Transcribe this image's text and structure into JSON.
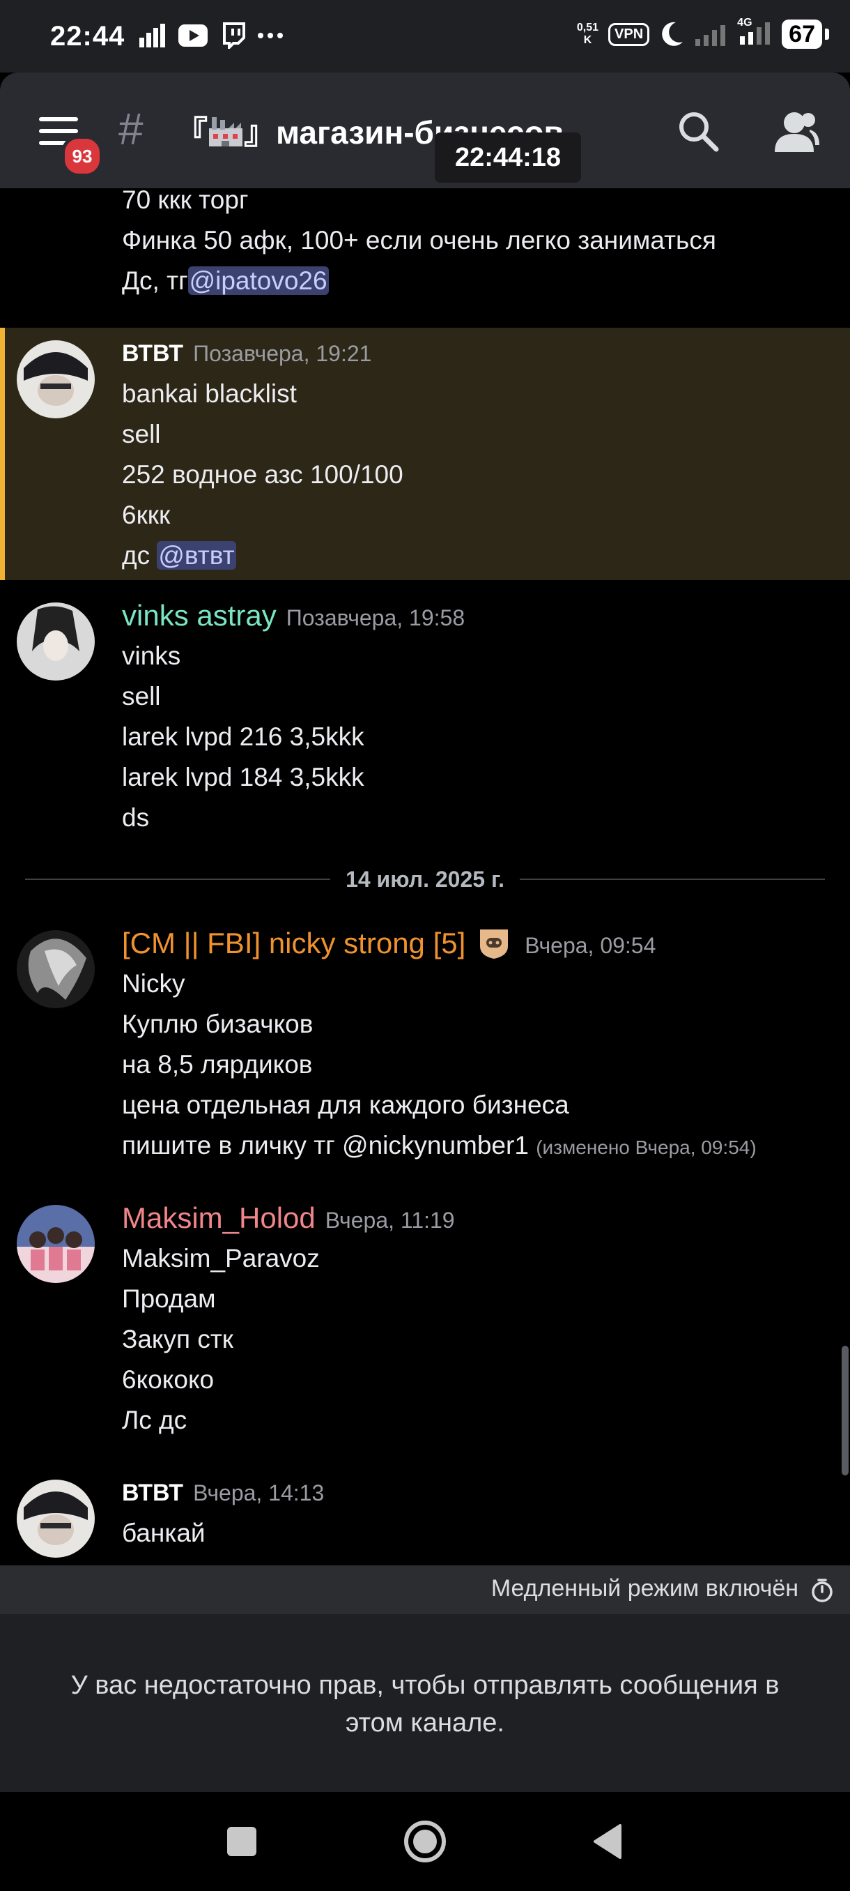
{
  "status_bar": {
    "time": "22:44",
    "net_speed_top": "0,51",
    "net_speed_bottom": "K",
    "vpn": "VPN",
    "network": "4G",
    "battery": "67"
  },
  "header": {
    "notification_count": "93",
    "channel_name": "『🏭』магазин-бизнесов",
    "channel_prefix": "『",
    "channel_suffix": "』магазин-бизнесов",
    "clock_overlay": "22:44:18"
  },
  "messages": {
    "partial_top": {
      "lines": [
        "70 ккк торг",
        "Финка 50 афк, 100+ если очень легко заниматься"
      ],
      "last_line_text": "Дс, тг",
      "last_line_mention": "@ipatovo26"
    },
    "msg1": {
      "author": "ВТВТ",
      "author_color": "#ffffff",
      "timestamp": "Позавчера, 19:21",
      "lines": [
        "bankai blacklist",
        "sell",
        "252 водное азс 100/100",
        "6ккк"
      ],
      "last_line_text": "дс ",
      "last_line_mention": "@втвт"
    },
    "msg2": {
      "author": "vinks astray",
      "author_color": "#7ae5c3",
      "timestamp": "Позавчера, 19:58",
      "lines": [
        "vinks",
        "sell",
        "larek lvpd 216 3,5kkk",
        "larek lvpd 184 3,5kkk",
        "ds"
      ]
    },
    "date_separator": "14 июл. 2025 г.",
    "msg3": {
      "author": "[CM || FBI] nicky strong [5]",
      "author_color": "#f0922d",
      "timestamp": "Вчера, 09:54",
      "lines": [
        "Nicky",
        "Куплю бизачков",
        "на 8,5 лярдиков",
        "цена отдельная для каждого бизнеса"
      ],
      "last_line_text": "пишите в личку  тг @nickynumber1",
      "edited": "(изменено Вчера, 09:54)"
    },
    "msg4": {
      "author": "Maksim_Holod",
      "author_color": "#f0858a",
      "timestamp": "Вчера, 11:19",
      "lines": [
        "Maksim_Paravoz",
        "Продам",
        "Закуп стк",
        "6кококо",
        "Лс дс"
      ]
    },
    "msg5": {
      "author": "ВТВТ",
      "author_color": "#ffffff",
      "timestamp": "Вчера, 14:13",
      "lines": [
        "банкай"
      ]
    }
  },
  "bottom": {
    "slowmode": "Медленный режим включён",
    "no_permission": "У вас недостаточно прав, чтобы отправлять сообщения в этом канале."
  },
  "icons": {
    "menu": "hamburger-icon",
    "search": "search-icon",
    "members": "members-icon",
    "timer": "timer-icon",
    "nav_recent": "square-icon",
    "nav_home": "circle-icon",
    "nav_back": "triangle-back-icon"
  }
}
